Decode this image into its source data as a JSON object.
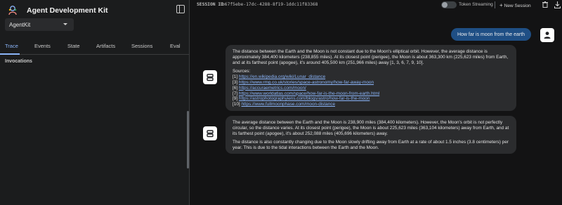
{
  "app": {
    "title": "Agent Development Kit",
    "selected_app": "AgentKit"
  },
  "tabs": [
    {
      "label": "Trace",
      "active": true
    },
    {
      "label": "Events",
      "active": false
    },
    {
      "label": "State",
      "active": false
    },
    {
      "label": "Artifacts",
      "active": false
    },
    {
      "label": "Sessions",
      "active": false
    },
    {
      "label": "Eval",
      "active": false
    }
  ],
  "sidebar": {
    "section_label": "Invocations"
  },
  "topbar": {
    "session_label": "SESSION ID",
    "session_id": "b67f5ebe-17dc-4288-8f19-1ddc11f83368",
    "streaming_label": "Token Streaming",
    "streaming_on": false,
    "new_session_label": "New Session"
  },
  "chat": {
    "user_message": "How far is moon from the earth",
    "reply1": {
      "body": "The distance between the Earth and the Moon is not constant due to the Moon's elliptical orbit. However, the average distance is approximately 384,400 kilometers (238,855 miles). At its closest point (perigee), the Moon is about 363,300 km (225,623 miles) from Earth, and at its farthest point (apogee), it's around 405,500 km (251,966 miles) away [1, 3, 6, 7, 9, 10].",
      "sources_label": "Sources:",
      "sources": [
        {
          "num": "[1]",
          "url": "https://en.wikipedia.org/wiki/Lunar_distance"
        },
        {
          "num": "[3]",
          "url": "https://www.rmg.co.uk/stories/space-astronomy/how-far-away-moon"
        },
        {
          "num": "[6]",
          "url": "https://accuraemetrics.com/moon/"
        },
        {
          "num": "[7]",
          "url": "https://www.worldatlas.com/space/how-far-is-the-moon-from-earth.html"
        },
        {
          "num": "[9]",
          "url": "https://astrophotographyiens.com/blogs/astro/how-far-is-the-moon"
        },
        {
          "num": "[10]",
          "url": "https://www.fullmoonphase.com/moon-distance"
        }
      ]
    },
    "reply2": {
      "para1": "The average distance between the Earth and the Moon is 238,900 miles (384,400 kilometers). However, the Moon's orbit is not perfectly circular, so the distance varies. At its closest point (perigee), the Moon is about 225,623 miles (363,104 kilometers) away from Earth, and at its farthest point (apogee), it's about 252,088 miles (405,696 kilometers) away.",
      "para2": "The distance is also constantly changing due to the Moon slowly drifting away from Earth at a rate of about 1.5 inches (3.8 centimeters) per year. This is due to the tidal interactions between the Earth and the Moon."
    }
  },
  "colors": {
    "accent": "#8ab4f8",
    "user_bubble": "#1f4f85",
    "bot_bubble": "#2b2c2e",
    "background": "#131314",
    "sidebar": "#1b1c1d"
  },
  "icons": {
    "logo": "adk-logo-icon",
    "toggle_sidebar": "sidebar-toggle-icon",
    "trash": "trash-icon",
    "download": "download-icon",
    "user": "person-icon",
    "bot": "robot-icon"
  }
}
